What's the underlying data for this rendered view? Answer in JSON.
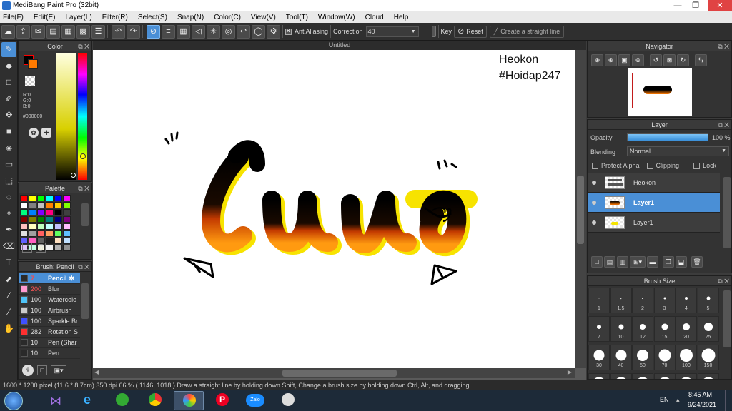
{
  "window": {
    "title": "MediBang Paint Pro (32bit)",
    "min": "—",
    "max": "❐",
    "close": "✕"
  },
  "menu": [
    "File(F)",
    "Edit(E)",
    "Layer(L)",
    "Filter(R)",
    "Select(S)",
    "Snap(N)",
    "Color(C)",
    "View(V)",
    "Tool(T)",
    "Window(W)",
    "Cloud",
    "Help"
  ],
  "toolbar": {
    "antialias_label": "AntiAliasing",
    "correction_label": "Correction",
    "correction_value": "40",
    "key_label": "Key",
    "reset_label": "Reset",
    "straight_line_label": "Create a straight line"
  },
  "color_panel": {
    "title": "Color",
    "r": "R:0",
    "g": "G:0",
    "b": "B:0",
    "hex": "#000000"
  },
  "palette_panel": {
    "title": "Palette",
    "extra": "---",
    "colors": [
      "#ff0000",
      "#ffff00",
      "#00ff00",
      "#00ffff",
      "#0000ff",
      "#ff00ff",
      "#ffffff",
      "#808080",
      "#c0c0c0",
      "#ff8000",
      "#ffcc00",
      "#80ff00",
      "#00ff80",
      "#0080ff",
      "#8000ff",
      "#ff0080",
      "#000000",
      "#404040",
      "#800000",
      "#808000",
      "#008000",
      "#008080",
      "#000080",
      "#800080",
      "#ffc0c0",
      "#ffffc0",
      "#c0ffc0",
      "#c0ffff",
      "#c0c0ff",
      "#ffc0ff",
      "#e0e0e0",
      "#a0a0a0",
      "#ff6060",
      "#ffa060",
      "#60ff60",
      "#60c0ff",
      "#6060ff",
      "#ff60c0",
      "#606060",
      "#202020",
      "#ffe0c0",
      "#c0e0ff",
      "#e0c0ff",
      "#c0ffe0",
      "#ffffe0",
      "#f0f0f0",
      "#b0b0b0",
      "#909090"
    ]
  },
  "brush_panel": {
    "title": "Brush: Pencil",
    "items": [
      {
        "size": "7",
        "name": "Pencil",
        "color": "#2a2a2a"
      },
      {
        "size": "200",
        "name": "Blur",
        "color": "#ff9ad0"
      },
      {
        "size": "100",
        "name": "Watercolo",
        "color": "#4fc3f7"
      },
      {
        "size": "100",
        "name": "Airbrush",
        "color": "#cccccc"
      },
      {
        "size": "100",
        "name": "Sparkle Br",
        "color": "#3f51ff"
      },
      {
        "size": "282",
        "name": "Rotation S",
        "color": "#ff3030"
      },
      {
        "size": "10",
        "name": "Pen (Shar",
        "color": "#2a2a2a"
      },
      {
        "size": "10",
        "name": "Pen",
        "color": "#2a2a2a"
      }
    ]
  },
  "canvas": {
    "tab": "Untitled",
    "text_line1": "Heokon",
    "text_line2": "#Hoidap247"
  },
  "navigator": {
    "title": "Navigator"
  },
  "layer_panel": {
    "title": "Layer",
    "opacity_label": "Opacity",
    "opacity_value": "100 %",
    "opacity_level": 1.0,
    "blending_label": "Blending",
    "blending_value": "Normal",
    "protect_alpha": "Protect Alpha",
    "clipping": "Clipping",
    "lock": "Lock",
    "layers": [
      {
        "name": "Heokon",
        "selected": false
      },
      {
        "name": "Layer1",
        "selected": true
      },
      {
        "name": "Layer1",
        "selected": false
      }
    ]
  },
  "brush_size_panel": {
    "title": "Brush Size",
    "sizes": [
      "1",
      "1.5",
      "2",
      "3",
      "4",
      "5",
      "7",
      "10",
      "12",
      "15",
      "20",
      "25",
      "30",
      "40",
      "50",
      "70",
      "100",
      "150",
      "",
      "",
      "",
      "",
      "",
      ""
    ]
  },
  "status": "1600 * 1200 pixel   (11.6 * 8.7cm)   350 dpi   66 %    ( 1146, 1018 )   Draw a straight line by holding down Shift, Change a brush size by holding down Ctrl, Alt, and dragging",
  "taskbar": {
    "lang": "EN",
    "time": "8:45 AM",
    "date": "9/24/2021",
    "zalo": "Zalo"
  }
}
